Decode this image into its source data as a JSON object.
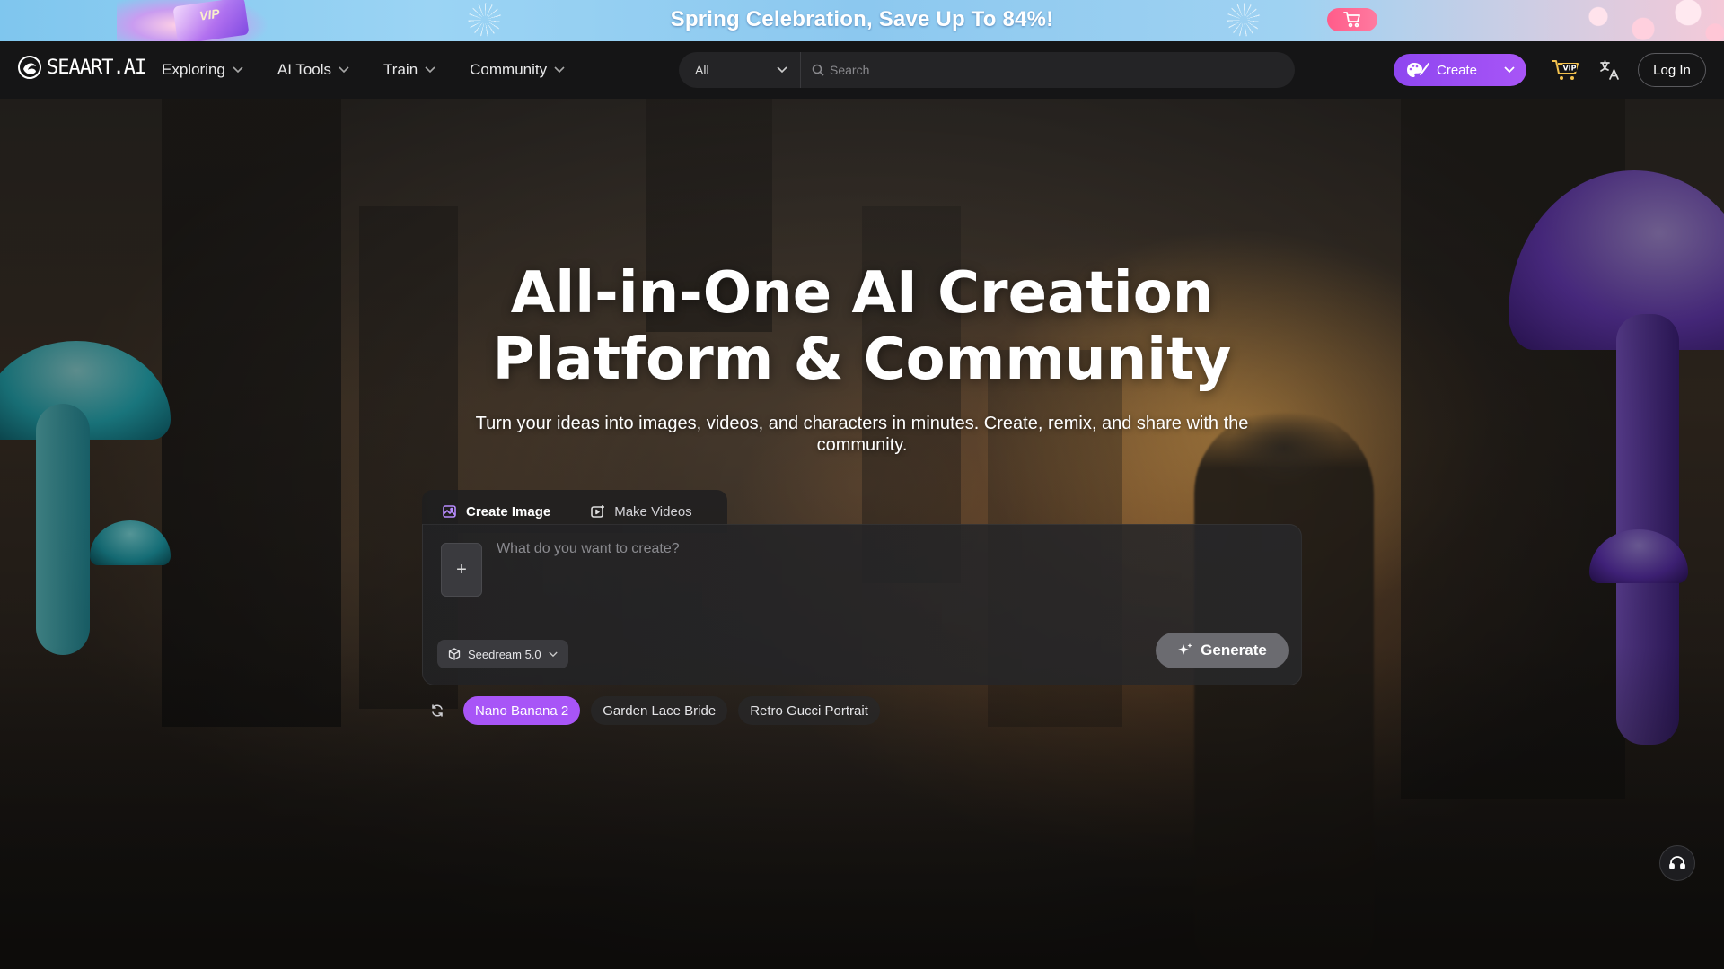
{
  "promo": {
    "title": "Spring Celebration, Save Up To 84%!",
    "badge": "VIP",
    "colors": {
      "sky": "#8cc8ef",
      "cart": "#ff5c8a"
    },
    "cart_icon": "cart-icon"
  },
  "nav": {
    "logo_text": "SEAART.AI",
    "menu": [
      {
        "label": "Exploring"
      },
      {
        "label": "AI Tools"
      },
      {
        "label": "Train"
      },
      {
        "label": "Community"
      }
    ],
    "search": {
      "filter_value": "All",
      "placeholder": "Search"
    },
    "create_label": "Create",
    "vip_label": "VIP",
    "login_label": "Log In",
    "accent": "#a855f7"
  },
  "hero": {
    "title_line1": "All-in-One AI Creation",
    "title_line2": "Platform & Community",
    "subtitle": "Turn your ideas into images, videos, and characters in minutes. Create, remix, and share with the community."
  },
  "creator": {
    "tabs": [
      {
        "label": "Create Image",
        "active": true
      },
      {
        "label": "Make Videos",
        "active": false
      }
    ],
    "upload_label": "+",
    "prompt_placeholder": "What do you want to create?",
    "model": "Seedream 5.0",
    "generate_label": "Generate"
  },
  "suggestions": [
    {
      "label": "Nano Banana 2",
      "active": true
    },
    {
      "label": "Garden Lace Bride",
      "active": false
    },
    {
      "label": "Retro Gucci Portrait",
      "active": false
    }
  ]
}
